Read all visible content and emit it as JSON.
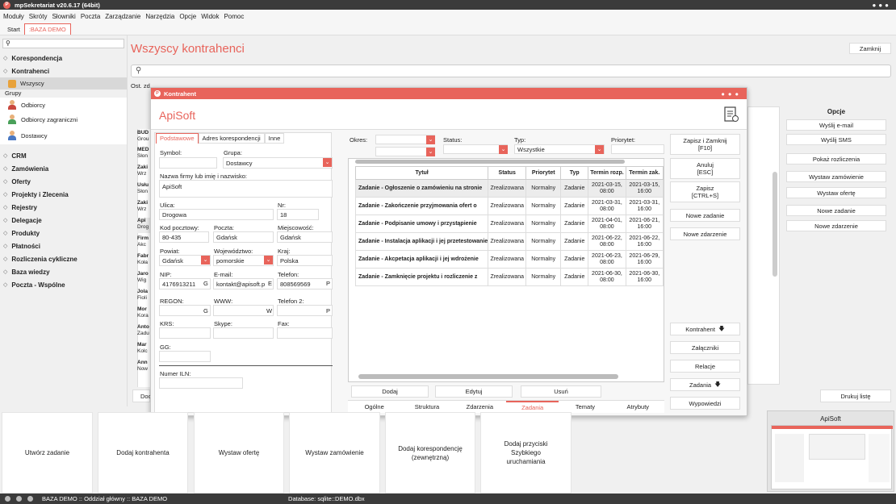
{
  "app": {
    "title": "mpSekretariat v20.6.17 (64bit)",
    "logo": "P"
  },
  "menu": [
    "Moduły",
    "Skróty",
    "Słowniki",
    "Poczta",
    "Zarządzanie",
    "Narzędzia",
    "Opcje",
    "Widok",
    "Pomoc"
  ],
  "tabs": {
    "start": "Start",
    "demo": ":BAZA DEMO"
  },
  "sidebar": {
    "search_icon": "search-icon",
    "sections_top": [
      "Korespondencja",
      "Kontrahenci"
    ],
    "selected_item": "Wszyscy",
    "groups_label": "Grupy",
    "groups": [
      "Odbiorcy",
      "Odbiorcy zagraniczni",
      "Dostawcy"
    ],
    "sections_bottom": [
      "CRM",
      "Zamówienia",
      "Oferty",
      "Projekty i Zlecenia",
      "Rejestry",
      "Delegacje",
      "Produkty",
      "Płatności",
      "Rozliczenia cykliczne",
      "Baza wiedzy",
      "Poczta - Wspólne"
    ]
  },
  "main": {
    "title": "Wszyscy kontrahenci",
    "close": "Zamknij",
    "ost_label": "Ost. zd",
    "list_partial": [
      [
        "BUD",
        "Grou"
      ],
      [
        "MED",
        "Słon"
      ],
      [
        "Zaki",
        "Wrz"
      ],
      [
        "Usłu",
        "Słon"
      ],
      [
        "Zaki",
        "Wrz"
      ],
      [
        "Api",
        "Drog"
      ],
      [
        "Firm",
        "Akc"
      ],
      [
        "Fabr",
        "Koła"
      ],
      [
        "Jaro",
        "Wig"
      ],
      [
        "Jola",
        "Fioli"
      ],
      [
        "Mor",
        "Kora"
      ],
      [
        "Anto",
        "Zadu"
      ],
      [
        "Mar",
        "Kolc"
      ],
      [
        "Ann",
        "Now"
      ]
    ],
    "doc_btn": "Doc"
  },
  "options": {
    "title": "Opcje",
    "buttons": [
      "Wyślij e-mail",
      "Wyślij SMS",
      "Pokaż rozliczenia",
      "Wystaw zamówienie",
      "Wystaw ofertę",
      "Nowe zadanie",
      "Nowe zdarzenie"
    ],
    "print": "Drukuj listę"
  },
  "dialog": {
    "window_title": "Kontrahent",
    "name": "ApiSoft",
    "tabs": [
      "Podstawowe",
      "Adres korespondencji",
      "Inne"
    ],
    "fields": {
      "symbol_label": "Symbol:",
      "symbol": "",
      "grupa_label": "Grupa:",
      "grupa": "Dostawcy",
      "nazwa_label": "Nazwa firmy lub imię i nazwisko:",
      "nazwa": "ApiSoft",
      "ulica_label": "Ulica:",
      "ulica": "Drogowa",
      "nr_label": "Nr:",
      "nr": "18",
      "kod_label": "Kod pocztowy:",
      "kod": "80-435",
      "poczta_label": "Poczta:",
      "poczta": "Gdańsk",
      "miejsc_label": "Miejscowość:",
      "miejsc": "Gdańsk",
      "powiat_label": "Powiat:",
      "powiat": "Gdańsk",
      "woj_label": "Województwo:",
      "woj": "pomorskie",
      "kraj_label": "Kraj:",
      "kraj": "Polska",
      "nip_label": "NIP:",
      "nip": "4176913211",
      "email_label": "E-mail:",
      "email": "kontakt@apisoft.p",
      "tel_label": "Telefon:",
      "tel": "808569569",
      "regon_label": "REGON:",
      "www_label": "WWW:",
      "tel2_label": "Telefon 2:",
      "krs_label": "KRS:",
      "skype_label": "Skype:",
      "fax_label": "Fax:",
      "gg_label": "GG:",
      "iln_label": "Numer ILN:",
      "g_btn": "G",
      "e_btn": "E",
      "w_btn": "W",
      "p_btn": "P"
    },
    "filters": {
      "okres": "Okres:",
      "status": "Status:",
      "typ": "Typ:",
      "typ_val": "Wszystkie",
      "priorytet": "Priorytet:"
    },
    "table": {
      "headers": [
        "Tytuł",
        "Status",
        "Priorytet",
        "Typ",
        "Termin rozp.",
        "Termin zak."
      ],
      "rows": [
        [
          "Zadanie - Ogłoszenie o zamówieniu na stronie",
          "Zrealizowana",
          "Normalny",
          "Zadanie",
          "2021-03-15, 08:00",
          "2021-03-15, 16:00"
        ],
        [
          "Zadanie - Zakończenie przyjmowania ofert o",
          "Zrealizowana",
          "Normalny",
          "Zadanie",
          "2021-03-31, 08:00",
          "2021-03-31, 16:00"
        ],
        [
          "Zadanie - Podpisanie umowy i przystąpienie",
          "Zrealizowana",
          "Normalny",
          "Zadanie",
          "2021-04-01, 08:00",
          "2021-06-21, 16:00"
        ],
        [
          "Zadanie - Instalacja aplikacji i jej przetestowanie",
          "Zrealizowana",
          "Normalny",
          "Zadanie",
          "2021-06-22, 08:00",
          "2021-06-22, 16:00"
        ],
        [
          "Zadanie - Akcpetacja aplikacji i jej wdrożenie",
          "Zrealizowana",
          "Normalny",
          "Zadanie",
          "2021-06-23, 08:00",
          "2021-06-29, 16:00"
        ],
        [
          "Zadanie - Zamknięcie projektu i rozliczenie z",
          "Zrealizowana",
          "Normalny",
          "Zadanie",
          "2021-06-30, 08:00",
          "2021-06-30, 16:00"
        ]
      ]
    },
    "action_buttons": {
      "dodaj": "Dodaj",
      "edytuj": "Edytuj",
      "usun": "Usuń"
    },
    "bottom_tabs": [
      "Ogólne",
      "Struktura",
      "Zdarzenia",
      "Zadania",
      "Tematy",
      "Atrybuty"
    ],
    "right_buttons": {
      "save_close": "Zapisz i Zamknij",
      "save_close_key": "[F10]",
      "cancel": "Anuluj",
      "cancel_key": "[ESC]",
      "save": "Zapisz",
      "save_key": "[CTRL+S]",
      "new_task": "Nowe zadanie",
      "new_event": "Nowe zdarzenie",
      "kontrahent": "Kontrahent",
      "zalaczniki": "Załączniki",
      "relacje": "Relacje",
      "zadania": "Zadania",
      "wypowiedzi": "Wypowiedzi"
    }
  },
  "tiles": [
    "Utwórz zadanie",
    "Dodaj kontrahenta",
    "Wystaw ofertę",
    "Wystaw zamówienie",
    "Dodaj korespondencję (zewnętrzną)",
    "Dodaj przyciski Szybkiego uruchamiania"
  ],
  "preview": {
    "title": "ApiSoft"
  },
  "status": {
    "left": "BAZA DEMO :: Oddział główny :: BAZA DEMO",
    "db": "Database: sqlite::DEMO.dbx"
  },
  "colors": {
    "accent": "#e8645b",
    "titlebar": "#3b3b3b"
  }
}
